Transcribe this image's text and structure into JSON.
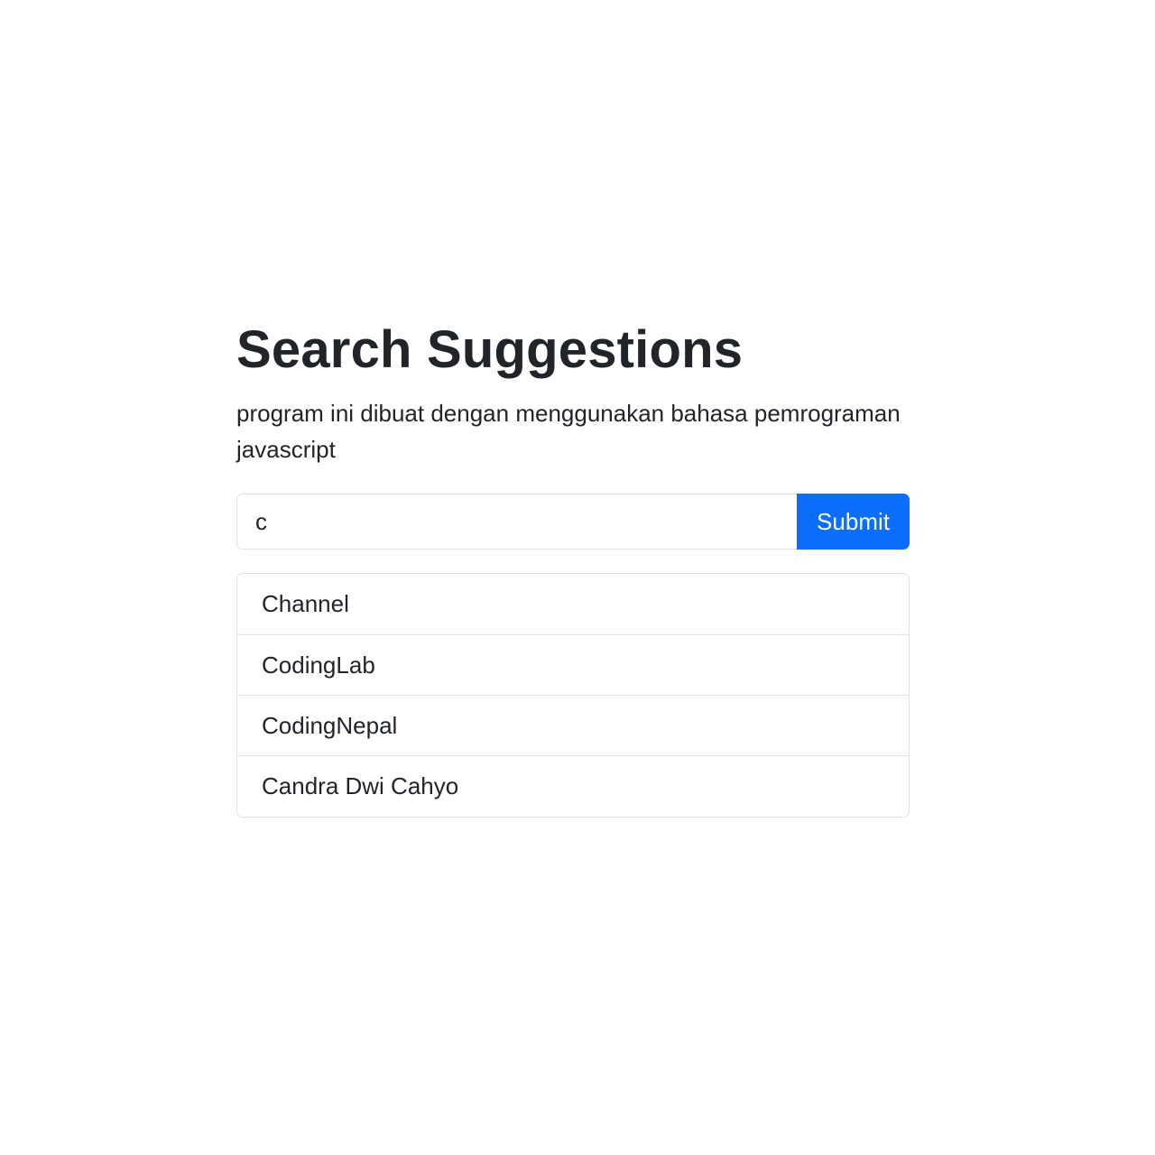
{
  "header": {
    "title": "Search Suggestions",
    "subtitle": "program ini dibuat dengan menggunakan bahasa pemrograman javascript"
  },
  "search": {
    "value": "c",
    "placeholder": "",
    "submit_label": "Submit"
  },
  "suggestions": [
    {
      "label": "Channel"
    },
    {
      "label": "CodingLab"
    },
    {
      "label": "CodingNepal"
    },
    {
      "label": "Candra Dwi Cahyo"
    }
  ],
  "colors": {
    "accent": "#0d6efd",
    "text": "#212529",
    "border": "#dee2e6",
    "background": "#ffffff"
  }
}
